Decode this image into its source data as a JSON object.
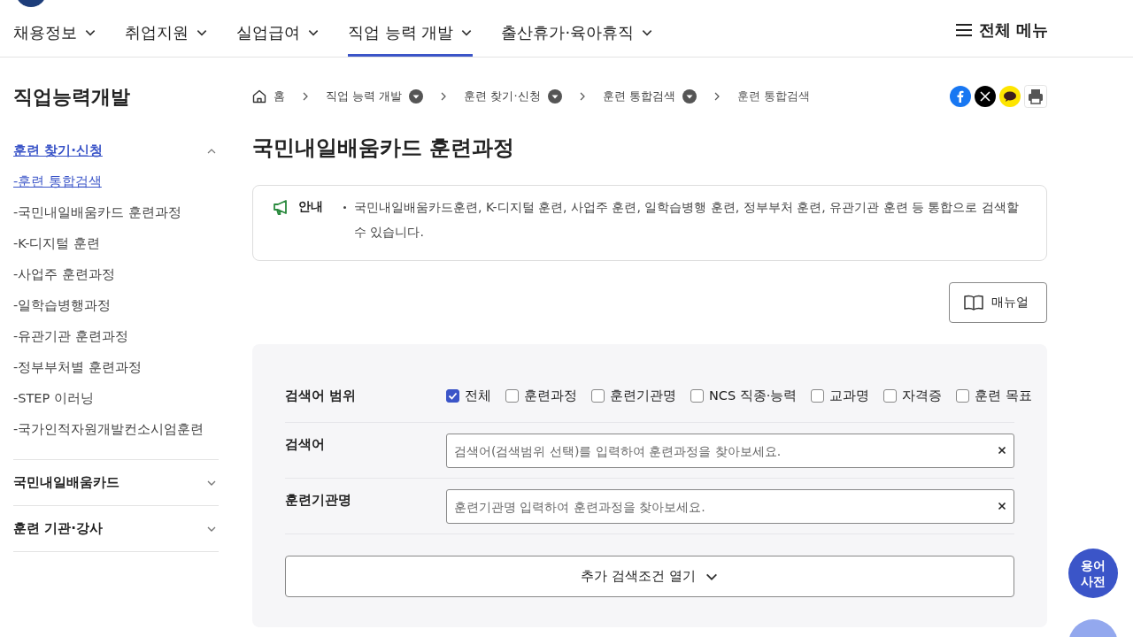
{
  "nav": {
    "items": [
      {
        "label": "채용정보",
        "selected": false
      },
      {
        "label": "취업지원",
        "selected": false
      },
      {
        "label": "실업급여",
        "selected": false
      },
      {
        "label": "직업 능력 개발",
        "selected": true
      },
      {
        "label": "출산휴가·육아휴직",
        "selected": false
      }
    ],
    "all_menu": "전체 메뉴"
  },
  "sidebar": {
    "title": "직업능력개발",
    "groups": [
      {
        "label": "훈련 찾기·신청",
        "expanded": true,
        "selected": true,
        "children": [
          {
            "label": "-훈련 통합검색",
            "selected": true
          },
          {
            "label": "-국민내일배움카드 훈련과정",
            "selected": false
          },
          {
            "label": "-K-디지털 훈련",
            "selected": false
          },
          {
            "label": "-사업주 훈련과정",
            "selected": false
          },
          {
            "label": "-일학습병행과정",
            "selected": false
          },
          {
            "label": "-유관기관 훈련과정",
            "selected": false
          },
          {
            "label": "-정부부처별 훈련과정",
            "selected": false
          },
          {
            "label": "-STEP 이러닝",
            "selected": false
          },
          {
            "label": "-국가인적자원개발컨소시엄훈련",
            "selected": false
          }
        ]
      },
      {
        "label": "국민내일배움카드",
        "expanded": false,
        "selected": false
      },
      {
        "label": "훈련 기관·강사",
        "expanded": false,
        "selected": false
      }
    ]
  },
  "breadcrumb": [
    {
      "label": "홈",
      "kind": "home"
    },
    {
      "label": "직업 능력 개발",
      "kind": "dropdown"
    },
    {
      "label": "훈련 찾기·신청",
      "kind": "dropdown"
    },
    {
      "label": "훈련 통합검색",
      "kind": "dropdown"
    },
    {
      "label": "훈련 통합검색",
      "kind": "current"
    }
  ],
  "share": [
    {
      "kind": "facebook"
    },
    {
      "kind": "x"
    },
    {
      "kind": "talk"
    },
    {
      "kind": "print"
    }
  ],
  "page_title": "국민내일배움카드 훈련과정",
  "notice": {
    "label": "안내",
    "text": "국민내일배움카드훈련, K-디지털 훈련, 사업주 훈련, 일학습병행 훈련, 정부부처 훈련, 유관기관 훈련 등 통합으로 검색할 수 있습니다."
  },
  "manual_button": "매뉴얼",
  "search": {
    "scope": {
      "label": "검색어 범위",
      "options": [
        {
          "label": "전체",
          "checked": true
        },
        {
          "label": "훈련과정",
          "checked": false
        },
        {
          "label": "훈련기관명",
          "checked": false
        },
        {
          "label": "NCS 직종·능력",
          "checked": false
        },
        {
          "label": "교과명",
          "checked": false
        },
        {
          "label": "자격증",
          "checked": false
        },
        {
          "label": "훈련 목표",
          "checked": false
        }
      ]
    },
    "fields": [
      {
        "label": "검색어",
        "placeholder": "검색어(검색범위 선택)를 입력하여 훈련과정을 찾아보세요."
      },
      {
        "label": "훈련기관명",
        "placeholder": "훈련기관명 입력하여 훈련과정을 찾아보세요."
      }
    ],
    "more_button": "추가 검색조건 열기"
  },
  "floating_button": {
    "lines": [
      "용어",
      "사전"
    ]
  }
}
